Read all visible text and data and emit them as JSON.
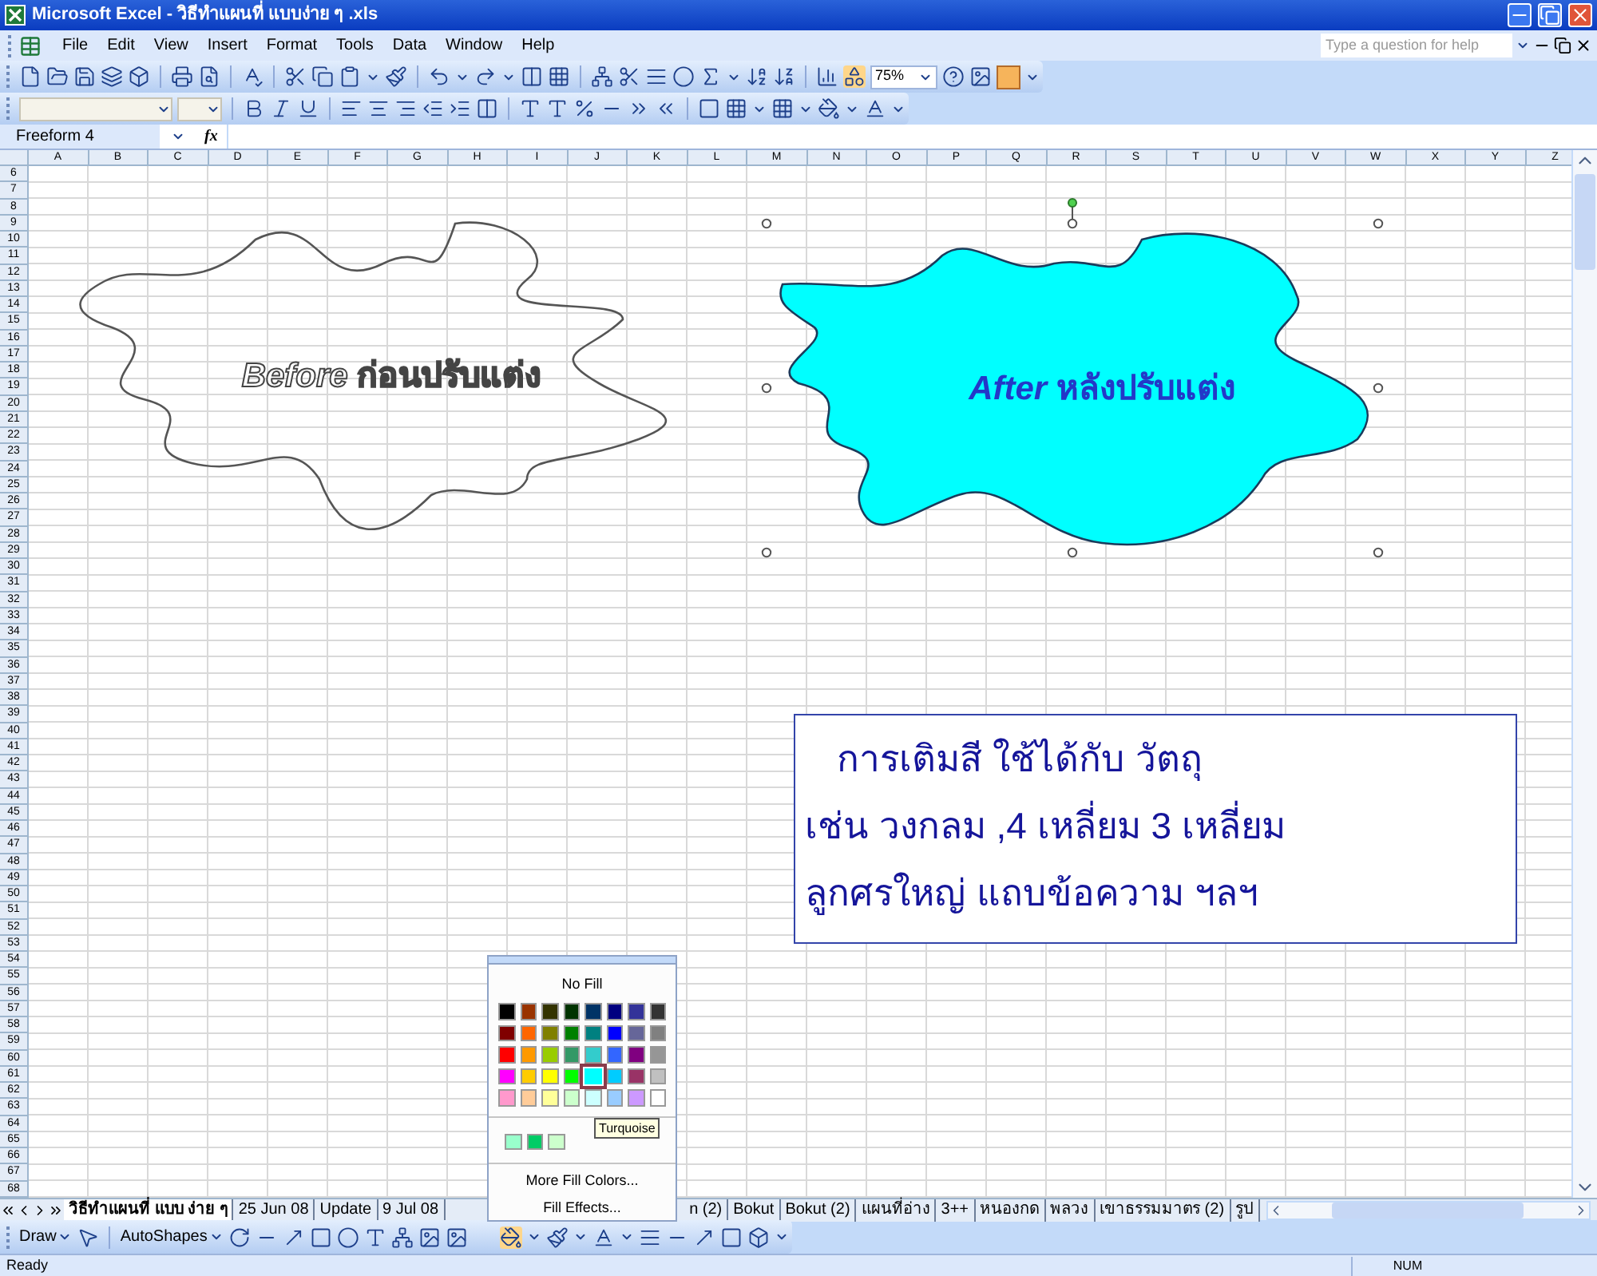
{
  "window": {
    "title": "Microsoft Excel - วิธีทำแผนที่ แบบง่าย ๆ .xls"
  },
  "menu": [
    "File",
    "Edit",
    "View",
    "Insert",
    "Format",
    "Tools",
    "Data",
    "Window",
    "Help"
  ],
  "help_search": {
    "placeholder": "Type a question for help"
  },
  "standard_toolbar": {
    "zoom": "75%"
  },
  "formula_bar": {
    "name_box": "Freeform 4",
    "function_label": "fx"
  },
  "columns": [
    "A",
    "B",
    "C",
    "D",
    "E",
    "F",
    "G",
    "H",
    "I",
    "J",
    "K",
    "L",
    "M",
    "N",
    "O",
    "P",
    "Q",
    "R",
    "S",
    "T",
    "U",
    "V",
    "W",
    "X",
    "Y",
    "Z"
  ],
  "rows": [
    "6",
    "7",
    "8",
    "9",
    "10",
    "11",
    "12",
    "13",
    "14",
    "15",
    "16",
    "17",
    "18",
    "19",
    "20",
    "21",
    "22",
    "23",
    "24",
    "25",
    "26",
    "27",
    "28",
    "29",
    "30",
    "31",
    "32",
    "33",
    "34",
    "35",
    "36",
    "37",
    "38",
    "39",
    "40",
    "41",
    "42",
    "43",
    "44",
    "45",
    "46",
    "47",
    "48",
    "49",
    "50",
    "51",
    "52",
    "53",
    "54",
    "55",
    "56",
    "57",
    "58",
    "59",
    "60",
    "61",
    "62",
    "63",
    "64",
    "65",
    "66",
    "67",
    "68"
  ],
  "shapes": [
    {
      "text": "*Before* ก่อนปรับแต่ง",
      "filled": false,
      "selected": false
    },
    {
      "text": "*After* หลังปรับแต่ง",
      "filled": true,
      "color": "#00ffff",
      "selected": true
    }
  ],
  "text_box": {
    "lines": [
      "การเติมสี ใช้ได้กับ วัตถุ",
      "เช่น วงกลม ,4 เหลี่ยม 3 เหลี่ยม",
      "ลูกศรใหญ่ แถบข้อความ ฯลฯ"
    ]
  },
  "fill_color_menu": {
    "no_fill": "No Fill",
    "colors": [
      [
        {
          "color": "#000000",
          "selected": false
        },
        {
          "color": "#993300",
          "selected": false
        },
        {
          "color": "#333300",
          "selected": false
        },
        {
          "color": "#003300",
          "selected": false
        },
        {
          "color": "#003366",
          "selected": false
        },
        {
          "color": "#000080",
          "selected": false
        },
        {
          "color": "#333399",
          "selected": false
        },
        {
          "color": "#333333",
          "selected": false
        }
      ],
      [
        {
          "color": "#800000",
          "selected": false
        },
        {
          "color": "#ff6600",
          "selected": false
        },
        {
          "color": "#808000",
          "selected": false
        },
        {
          "color": "#008000",
          "selected": false
        },
        {
          "color": "#008080",
          "selected": false
        },
        {
          "color": "#0000ff",
          "selected": false
        },
        {
          "color": "#666699",
          "selected": false
        },
        {
          "color": "#808080",
          "selected": false
        }
      ],
      [
        {
          "color": "#ff0000",
          "selected": false
        },
        {
          "color": "#ff9900",
          "selected": false
        },
        {
          "color": "#99cc00",
          "selected": false
        },
        {
          "color": "#339966",
          "selected": false
        },
        {
          "color": "#33cccc",
          "selected": false
        },
        {
          "color": "#3366ff",
          "selected": false
        },
        {
          "color": "#800080",
          "selected": false
        },
        {
          "color": "#969696",
          "selected": false
        }
      ],
      [
        {
          "color": "#ff00ff",
          "selected": false
        },
        {
          "color": "#ffcc00",
          "selected": false
        },
        {
          "color": "#ffff00",
          "selected": false
        },
        {
          "color": "#00ff00",
          "selected": false
        },
        {
          "color": "#00ffff",
          "selected": true
        },
        {
          "color": "#00ccff",
          "selected": false
        },
        {
          "color": "#993366",
          "selected": false
        },
        {
          "color": "#c0c0c0",
          "selected": false
        }
      ],
      [
        {
          "color": "#ff99cc",
          "selected": false
        },
        {
          "color": "#ffcc99",
          "selected": false
        },
        {
          "color": "#ffff99",
          "selected": false
        },
        {
          "color": "#ccffcc",
          "selected": false
        },
        {
          "color": "#ccffff",
          "selected": false
        },
        {
          "color": "#99ccff",
          "selected": false
        },
        {
          "color": "#cc99ff",
          "selected": false
        },
        {
          "color": "#ffffff",
          "selected": false
        }
      ]
    ],
    "recent_colors": [
      {
        "color": "#99ffcc"
      },
      {
        "color": "#00cc66"
      },
      {
        "color": "#ccffcc"
      }
    ],
    "tooltip": "Turquoise",
    "items": [
      "More Fill Colors...",
      "Fill Effects..."
    ]
  },
  "sheet_tabs": [
    {
      "label": "วิธีทำแผนที่ แบบ ง่าย ๆ",
      "selected": true
    },
    {
      "label": "25 Jun 08",
      "selected": false
    },
    {
      "label": "Update",
      "selected": false
    },
    {
      "label": "9 Jul 08",
      "selected": false
    },
    {
      "label": "n (2)",
      "selected": false
    },
    {
      "label": "Bokut",
      "selected": false
    },
    {
      "label": "Bokut (2)",
      "selected": false
    },
    {
      "label": "แผนที่อ่าง",
      "selected": false
    },
    {
      "label": "3++",
      "selected": false
    },
    {
      "label": "หนองกด",
      "selected": false
    },
    {
      "label": "พลวง",
      "selected": false
    },
    {
      "label": "เขาธรรมมาตร (2)",
      "selected": false
    },
    {
      "label": "รูป",
      "selected": false
    }
  ],
  "drawing_toolbar": {
    "draw": "Draw",
    "autoshapes": "AutoShapes"
  },
  "status_bar": {
    "status": "Ready",
    "indicators": [
      "NUM"
    ]
  }
}
